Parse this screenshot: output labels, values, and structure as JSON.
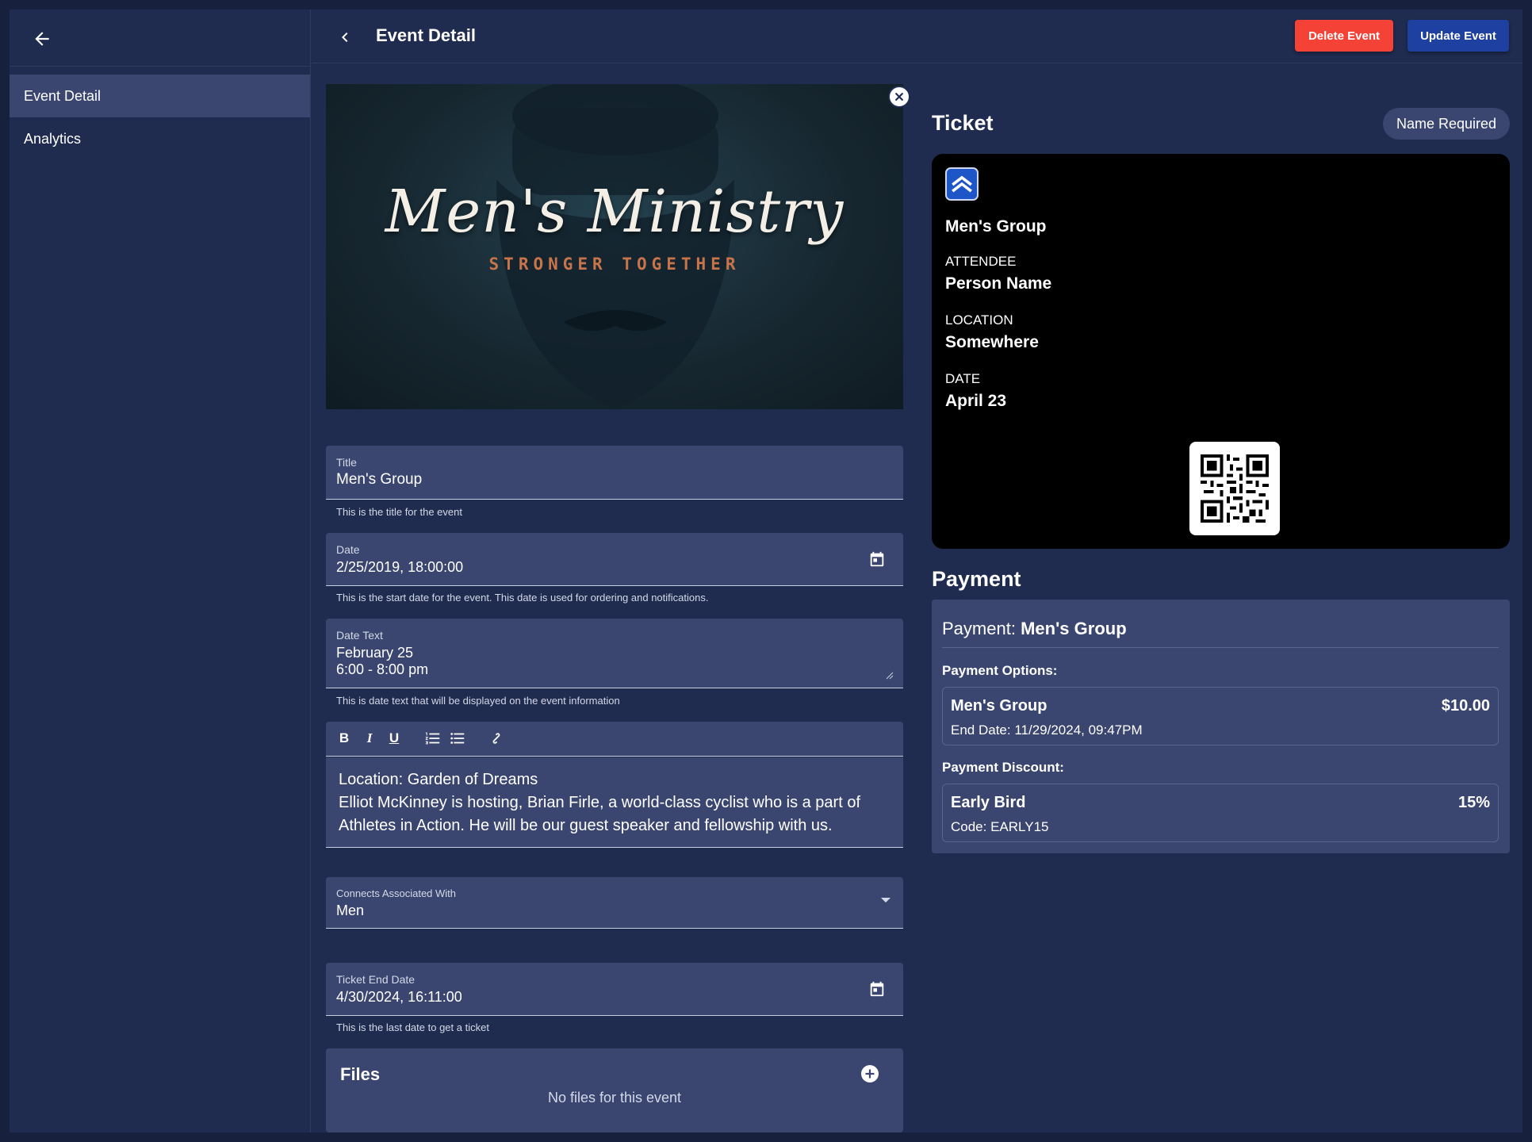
{
  "sidebar": {
    "items": [
      {
        "label": "Event Detail"
      },
      {
        "label": "Analytics"
      }
    ]
  },
  "header": {
    "title": "Event Detail",
    "delete_label": "Delete Event",
    "update_label": "Update Event"
  },
  "banner": {
    "title": "Men's Ministry",
    "subtitle": "STRONGER TOGETHER"
  },
  "form": {
    "title": {
      "label": "Title",
      "value": "Men's Group",
      "helper": "This is the title for the event"
    },
    "date": {
      "label": "Date",
      "value": "2/25/2019, 18:00:00",
      "helper": "This is the start date for the event. This date is used for ordering and notifications."
    },
    "date_text": {
      "label": "Date Text",
      "line1": "February 25",
      "line2": "6:00 - 8:00 pm",
      "helper": "This is date text that will be displayed on the event information"
    },
    "description": {
      "line1": "Location: Garden of Dreams",
      "line2": "Elliot McKinney is hosting, Brian Firle, a world-class cyclist who is a part of",
      "line3": "Athletes in Action. He will be our guest speaker and fellowship with us."
    },
    "connects": {
      "label": "Connects Associated With",
      "value": "Men"
    },
    "ticket_end": {
      "label": "Ticket End Date",
      "value": "4/30/2024, 16:11:00",
      "helper": "This is the last date to get a ticket"
    }
  },
  "files": {
    "title": "Files",
    "empty": "No files for this event"
  },
  "ticket": {
    "section_title": "Ticket",
    "chip": "Name Required",
    "name": "Men's Group",
    "attendee_label": "ATTENDEE",
    "attendee_value": "Person Name",
    "location_label": "LOCATION",
    "location_value": "Somewhere",
    "date_label": "DATE",
    "date_value": "April 23"
  },
  "payment": {
    "section_title": "Payment",
    "head_prefix": "Payment:",
    "head_name": "Men's Group",
    "options_label": "Payment Options:",
    "option": {
      "name": "Men's Group",
      "price": "$10.00",
      "meta": "End Date: 11/29/2024, 09:47PM"
    },
    "discount_label": "Payment Discount:",
    "discount": {
      "name": "Early Bird",
      "value": "15%",
      "meta": "Code: EARLY15"
    }
  },
  "colors": {
    "background": "#1f2b4f",
    "field": "#3a4670",
    "delete": "#f44336",
    "update": "#1e40a0"
  }
}
